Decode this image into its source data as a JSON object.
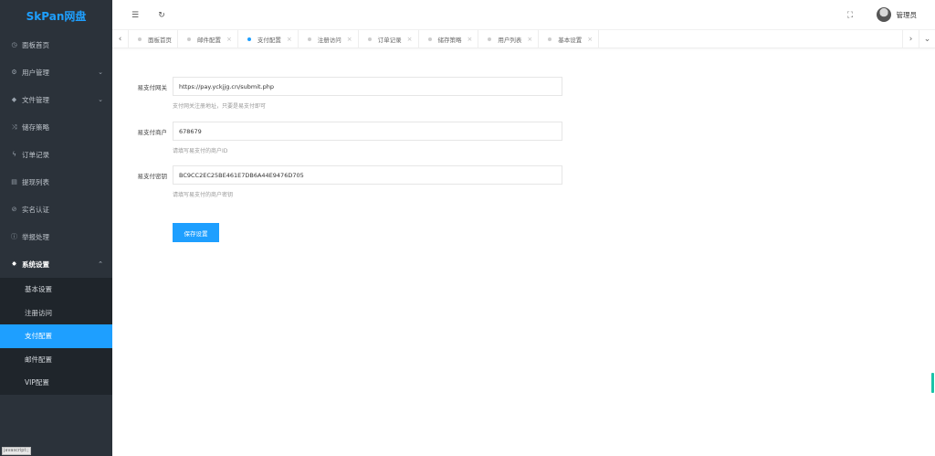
{
  "sidebar": {
    "logo": "SkPan网盘",
    "menu": [
      {
        "label": "面板首页",
        "icon": "dashboard-icon",
        "glyph": "◷"
      },
      {
        "label": "用户管理",
        "icon": "user-icon",
        "glyph": "⚙",
        "arrow": "⌄"
      },
      {
        "label": "文件管理",
        "icon": "file-icon",
        "glyph": "◆",
        "arrow": "⌄"
      },
      {
        "label": "储存策略",
        "icon": "storage-icon",
        "glyph": "⤨"
      },
      {
        "label": "订单记录",
        "icon": "order-icon",
        "glyph": "ϟ"
      },
      {
        "label": "提现列表",
        "icon": "withdraw-icon",
        "glyph": "▤"
      },
      {
        "label": "实名认证",
        "icon": "verify-icon",
        "glyph": "⊘"
      },
      {
        "label": "举报处理",
        "icon": "report-icon",
        "glyph": "ⓘ"
      },
      {
        "label": "系统设置",
        "icon": "settings-icon",
        "glyph": "✸",
        "arrow": "⌃"
      }
    ],
    "submenu": [
      {
        "label": "基本设置"
      },
      {
        "label": "注册访问"
      },
      {
        "label": "支付配置"
      },
      {
        "label": "邮件配置"
      },
      {
        "label": "VIP配置"
      }
    ],
    "status_hint": "javascript:;"
  },
  "header": {
    "menu_toggle_glyph": "☰",
    "refresh_glyph": "↻",
    "fullscreen_glyph": "⛶",
    "username": "管理员"
  },
  "tabs": {
    "prev_glyph": "‹",
    "next_glyph": "›",
    "more_glyph": "⌄",
    "items": [
      {
        "label": "面板首页",
        "closable": false
      },
      {
        "label": "邮件配置",
        "closable": true
      },
      {
        "label": "支付配置",
        "closable": true,
        "active": true
      },
      {
        "label": "注册访问",
        "closable": true
      },
      {
        "label": "订单记录",
        "closable": true
      },
      {
        "label": "储存策略",
        "closable": true
      },
      {
        "label": "用户列表",
        "closable": true
      },
      {
        "label": "基本设置",
        "closable": true
      }
    ],
    "close_glyph": "×"
  },
  "form": {
    "gateway": {
      "label": "易支付网关",
      "value": "https://pay.yckjjg.cn/submit.php",
      "hint": "支付网关注册地址，只要是易支付即可"
    },
    "merchant": {
      "label": "易支付商户",
      "value": "678679",
      "hint": "请填写易支付的商户ID"
    },
    "key": {
      "label": "易支付密钥",
      "value": "BC9CC2EC25BE461E7DB6A44E9476D705",
      "hint": "请填写易支付的商户密钥"
    },
    "save_label": "保存设置"
  },
  "colors": {
    "accent": "#1e9fff",
    "sidebar_bg": "#2b323a",
    "submenu_bg": "#1f252b"
  }
}
